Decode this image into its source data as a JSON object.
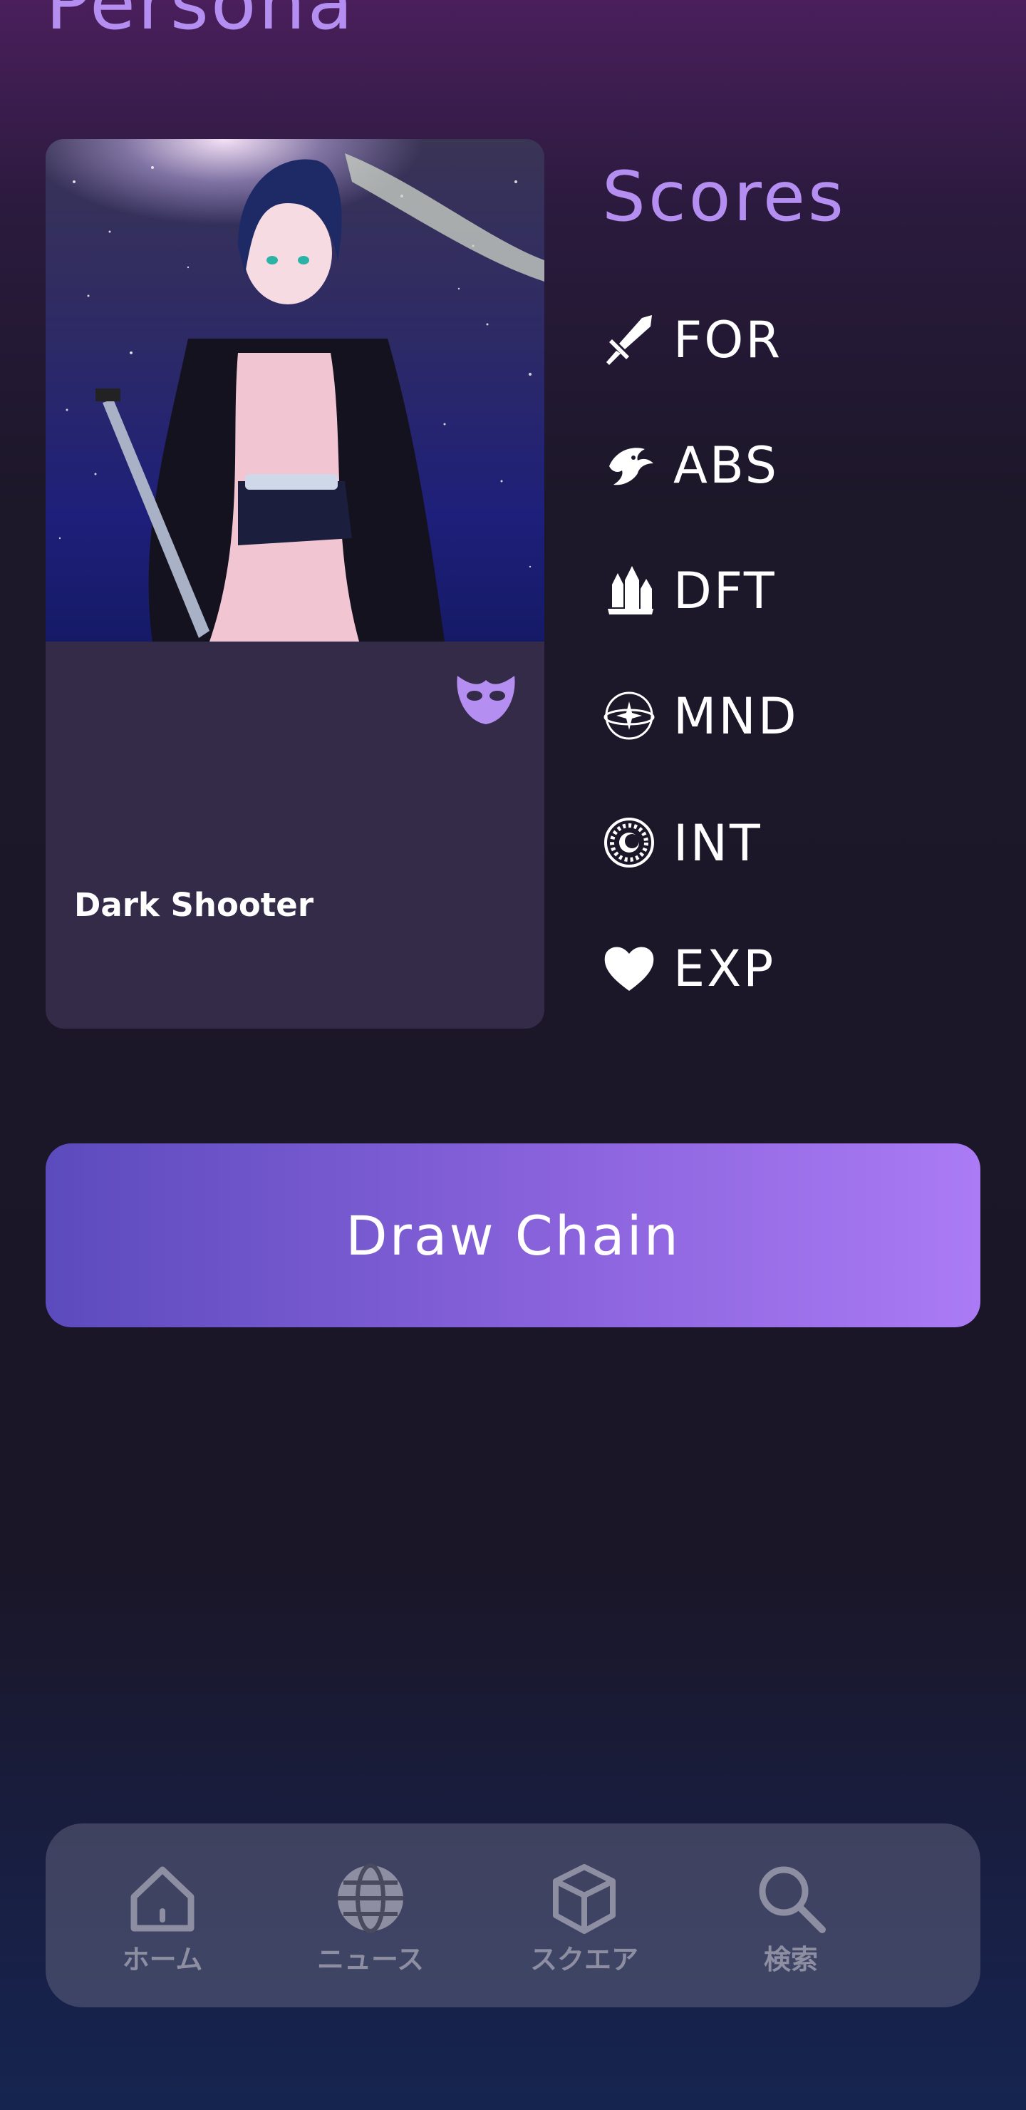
{
  "header": {
    "title": "Persona"
  },
  "persona_card": {
    "name": "Dark Shooter",
    "image_icon": "anime-character-artwork",
    "badge_icon": "mask-icon"
  },
  "scores": {
    "title": "Scores",
    "items": [
      {
        "label": "FOR",
        "icon": "sword-icon"
      },
      {
        "label": "ABS",
        "icon": "dragon-icon"
      },
      {
        "label": "DFT",
        "icon": "crystal-icon"
      },
      {
        "label": "MND",
        "icon": "orbit-icon"
      },
      {
        "label": "INT",
        "icon": "zodiac-icon"
      },
      {
        "label": "EXP",
        "icon": "heart-icon"
      }
    ]
  },
  "actions": {
    "draw_chain": "Draw Chain"
  },
  "bottom_nav": {
    "items": [
      {
        "label": "ホーム",
        "icon": "home-icon"
      },
      {
        "label": "ニュース",
        "icon": "globe-icon"
      },
      {
        "label": "スクエア",
        "icon": "cube-icon"
      },
      {
        "label": "検索",
        "icon": "search-icon"
      }
    ]
  },
  "colors": {
    "accent": "#b48ef0",
    "card_bg": "#332b47",
    "button_start": "#5c4bbd",
    "button_end": "#aa7bf5",
    "nav_label": "#8e8ea2"
  }
}
